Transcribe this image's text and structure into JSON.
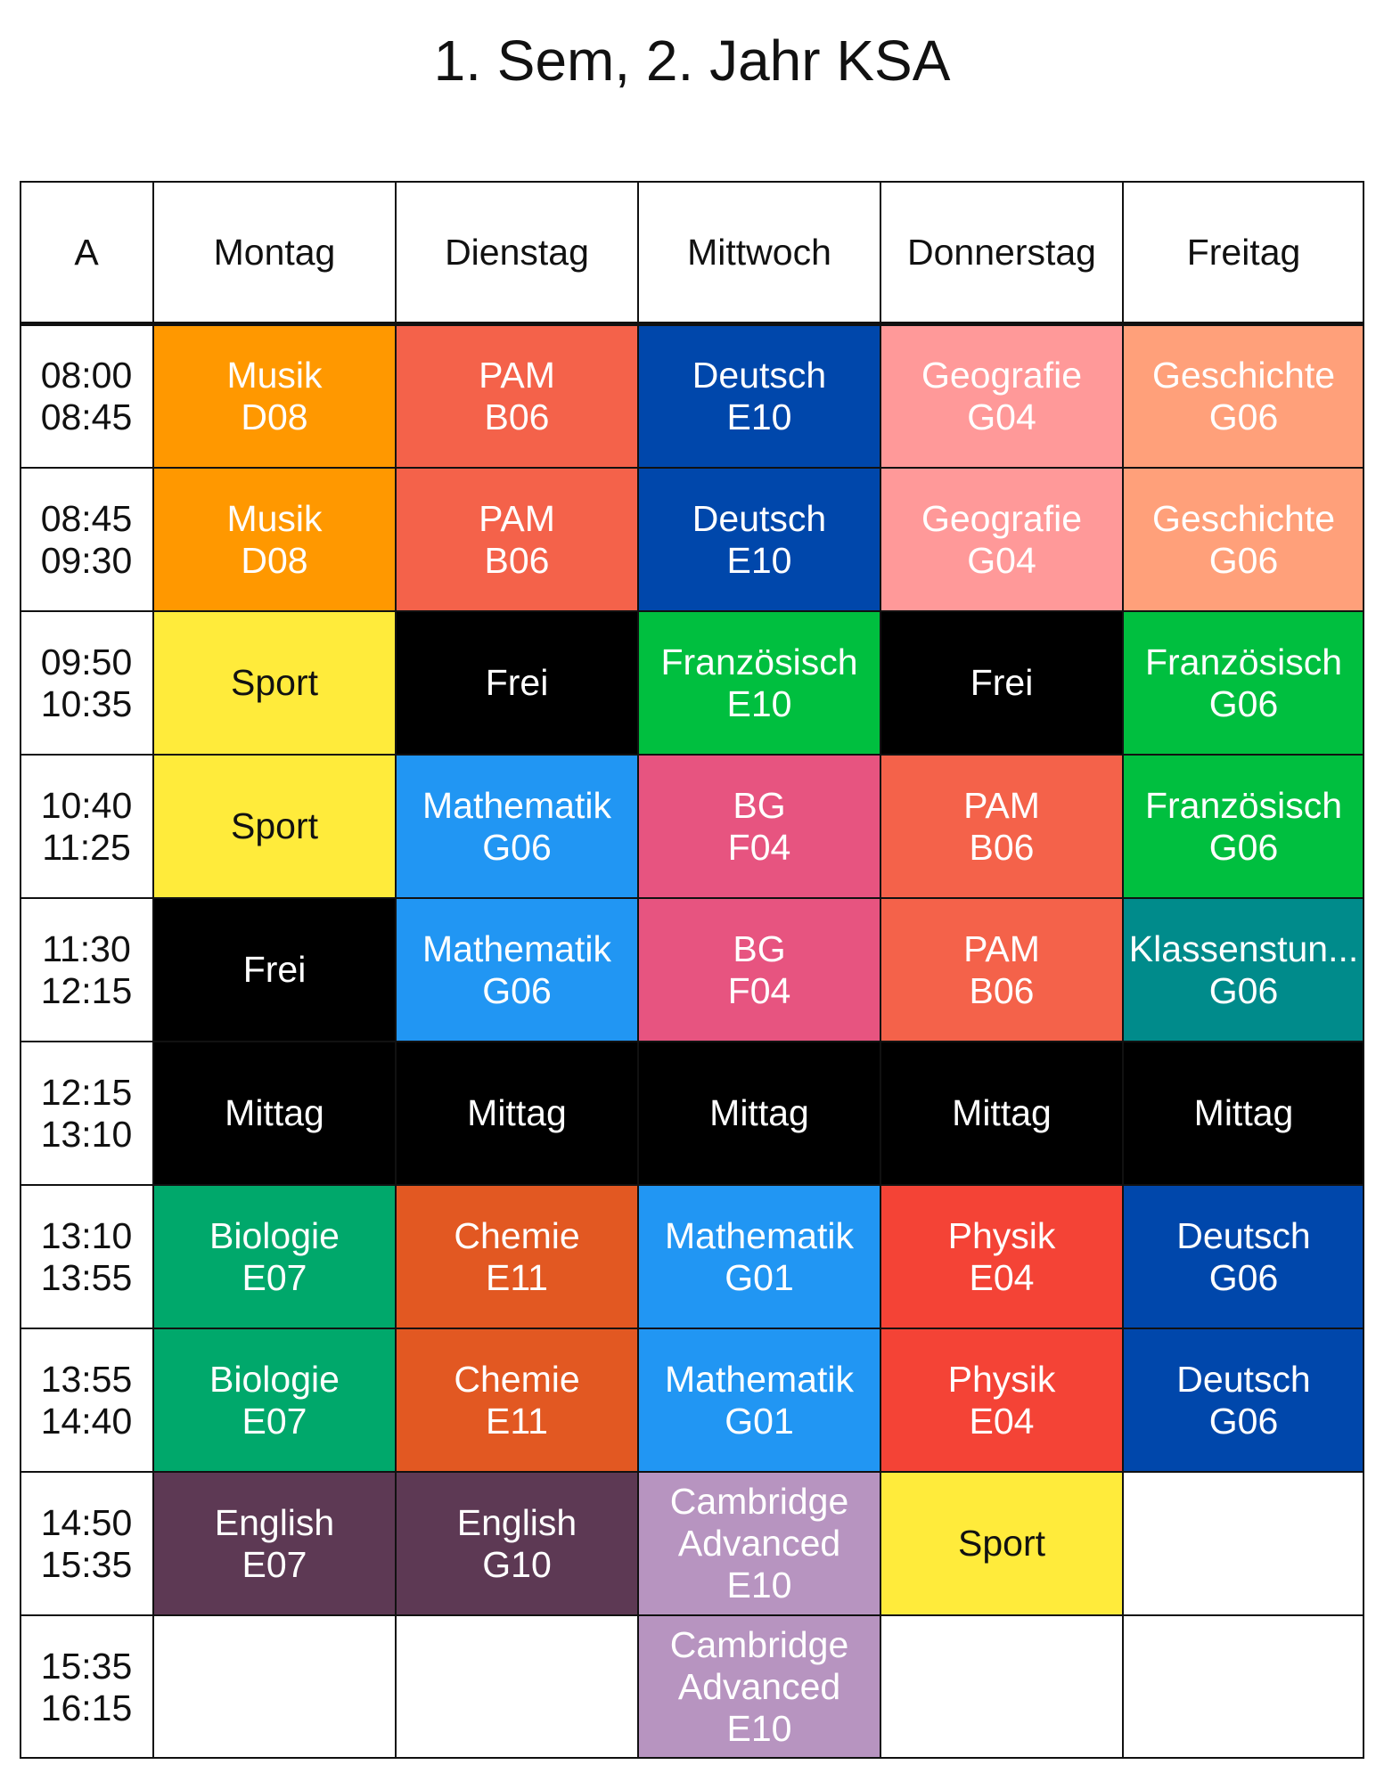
{
  "title": "1. Sem, 2. Jahr KSA",
  "corner": "A",
  "days": [
    "Montag",
    "Dienstag",
    "Mittwoch",
    "Donnerstag",
    "Freitag"
  ],
  "times": [
    [
      "08:00",
      "08:45"
    ],
    [
      "08:45",
      "09:30"
    ],
    [
      "09:50",
      "10:35"
    ],
    [
      "10:40",
      "11:25"
    ],
    [
      "11:30",
      "12:15"
    ],
    [
      "12:15",
      "13:10"
    ],
    [
      "13:10",
      "13:55"
    ],
    [
      "13:55",
      "14:40"
    ],
    [
      "14:50",
      "15:35"
    ],
    [
      "15:35",
      "16:15"
    ]
  ],
  "rows": [
    [
      {
        "lines": [
          "Musik",
          "D08"
        ],
        "bg": "#FF9800",
        "fg": "#ffffff"
      },
      {
        "lines": [
          "PAM",
          "B06"
        ],
        "bg": "#F4624A",
        "fg": "#ffffff"
      },
      {
        "lines": [
          "Deutsch",
          "E10"
        ],
        "bg": "#0047AB",
        "fg": "#ffffff"
      },
      {
        "lines": [
          "Geografie",
          "G04"
        ],
        "bg": "#FF9999",
        "fg": "#ffffff"
      },
      {
        "lines": [
          "Geschichte",
          "G06"
        ],
        "bg": "#FFA07A",
        "fg": "#ffffff"
      }
    ],
    [
      {
        "lines": [
          "Musik",
          "D08"
        ],
        "bg": "#FF9800",
        "fg": "#ffffff"
      },
      {
        "lines": [
          "PAM",
          "B06"
        ],
        "bg": "#F4624A",
        "fg": "#ffffff"
      },
      {
        "lines": [
          "Deutsch",
          "E10"
        ],
        "bg": "#0047AB",
        "fg": "#ffffff"
      },
      {
        "lines": [
          "Geografie",
          "G04"
        ],
        "bg": "#FF9999",
        "fg": "#ffffff"
      },
      {
        "lines": [
          "Geschichte",
          "G06"
        ],
        "bg": "#FFA07A",
        "fg": "#ffffff"
      }
    ],
    [
      {
        "lines": [
          "Sport"
        ],
        "bg": "#FFEB3B",
        "fg": "#111111"
      },
      {
        "lines": [
          "Frei"
        ],
        "bg": "#000000",
        "fg": "#ffffff"
      },
      {
        "lines": [
          "Französisch",
          "E10"
        ],
        "bg": "#00BF3F",
        "fg": "#ffffff"
      },
      {
        "lines": [
          "Frei"
        ],
        "bg": "#000000",
        "fg": "#ffffff"
      },
      {
        "lines": [
          "Französisch",
          "G06"
        ],
        "bg": "#00BF3F",
        "fg": "#ffffff"
      }
    ],
    [
      {
        "lines": [
          "Sport"
        ],
        "bg": "#FFEB3B",
        "fg": "#111111"
      },
      {
        "lines": [
          "Mathematik",
          "G06"
        ],
        "bg": "#2196F3",
        "fg": "#ffffff"
      },
      {
        "lines": [
          "BG",
          "F04"
        ],
        "bg": "#E75480",
        "fg": "#ffffff"
      },
      {
        "lines": [
          "PAM",
          "B06"
        ],
        "bg": "#F4624A",
        "fg": "#ffffff"
      },
      {
        "lines": [
          "Französisch",
          "G06"
        ],
        "bg": "#00BF3F",
        "fg": "#ffffff"
      }
    ],
    [
      {
        "lines": [
          "Frei"
        ],
        "bg": "#000000",
        "fg": "#ffffff"
      },
      {
        "lines": [
          "Mathematik",
          "G06"
        ],
        "bg": "#2196F3",
        "fg": "#ffffff"
      },
      {
        "lines": [
          "BG",
          "F04"
        ],
        "bg": "#E75480",
        "fg": "#ffffff"
      },
      {
        "lines": [
          "PAM",
          "B06"
        ],
        "bg": "#F4624A",
        "fg": "#ffffff"
      },
      {
        "lines": [
          "Klassenstun...",
          "G06"
        ],
        "bg": "#008B8B",
        "fg": "#ffffff"
      }
    ],
    [
      {
        "lines": [
          "Mittag"
        ],
        "bg": "#000000",
        "fg": "#ffffff"
      },
      {
        "lines": [
          "Mittag"
        ],
        "bg": "#000000",
        "fg": "#ffffff"
      },
      {
        "lines": [
          "Mittag"
        ],
        "bg": "#000000",
        "fg": "#ffffff"
      },
      {
        "lines": [
          "Mittag"
        ],
        "bg": "#000000",
        "fg": "#ffffff"
      },
      {
        "lines": [
          "Mittag"
        ],
        "bg": "#000000",
        "fg": "#ffffff"
      }
    ],
    [
      {
        "lines": [
          "Biologie",
          "E07"
        ],
        "bg": "#00A86B",
        "fg": "#ffffff"
      },
      {
        "lines": [
          "Chemie",
          "E11"
        ],
        "bg": "#E25822",
        "fg": "#ffffff"
      },
      {
        "lines": [
          "Mathematik",
          "G01"
        ],
        "bg": "#2196F3",
        "fg": "#ffffff"
      },
      {
        "lines": [
          "Physik",
          "E04"
        ],
        "bg": "#F44336",
        "fg": "#ffffff"
      },
      {
        "lines": [
          "Deutsch",
          "G06"
        ],
        "bg": "#0047AB",
        "fg": "#ffffff"
      }
    ],
    [
      {
        "lines": [
          "Biologie",
          "E07"
        ],
        "bg": "#00A86B",
        "fg": "#ffffff"
      },
      {
        "lines": [
          "Chemie",
          "E11"
        ],
        "bg": "#E25822",
        "fg": "#ffffff"
      },
      {
        "lines": [
          "Mathematik",
          "G01"
        ],
        "bg": "#2196F3",
        "fg": "#ffffff"
      },
      {
        "lines": [
          "Physik",
          "E04"
        ],
        "bg": "#F44336",
        "fg": "#ffffff"
      },
      {
        "lines": [
          "Deutsch",
          "G06"
        ],
        "bg": "#0047AB",
        "fg": "#ffffff"
      }
    ],
    [
      {
        "lines": [
          "English",
          "E07"
        ],
        "bg": "#5D3954",
        "fg": "#ffffff"
      },
      {
        "lines": [
          "English",
          "G10"
        ],
        "bg": "#5D3954",
        "fg": "#ffffff"
      },
      {
        "lines": [
          "Cambridge",
          "Advanced",
          "E10"
        ],
        "bg": "#B794C0",
        "fg": "#ffffff"
      },
      {
        "lines": [
          "Sport"
        ],
        "bg": "#FFEB3B",
        "fg": "#111111"
      },
      {
        "lines": [],
        "bg": "#ffffff",
        "fg": "#111111"
      }
    ],
    [
      {
        "lines": [],
        "bg": "#ffffff",
        "fg": "#111111"
      },
      {
        "lines": [],
        "bg": "#ffffff",
        "fg": "#111111"
      },
      {
        "lines": [
          "Cambridge",
          "Advanced",
          "E10"
        ],
        "bg": "#B794C0",
        "fg": "#ffffff"
      },
      {
        "lines": [],
        "bg": "#ffffff",
        "fg": "#111111"
      },
      {
        "lines": [],
        "bg": "#ffffff",
        "fg": "#111111"
      }
    ]
  ]
}
